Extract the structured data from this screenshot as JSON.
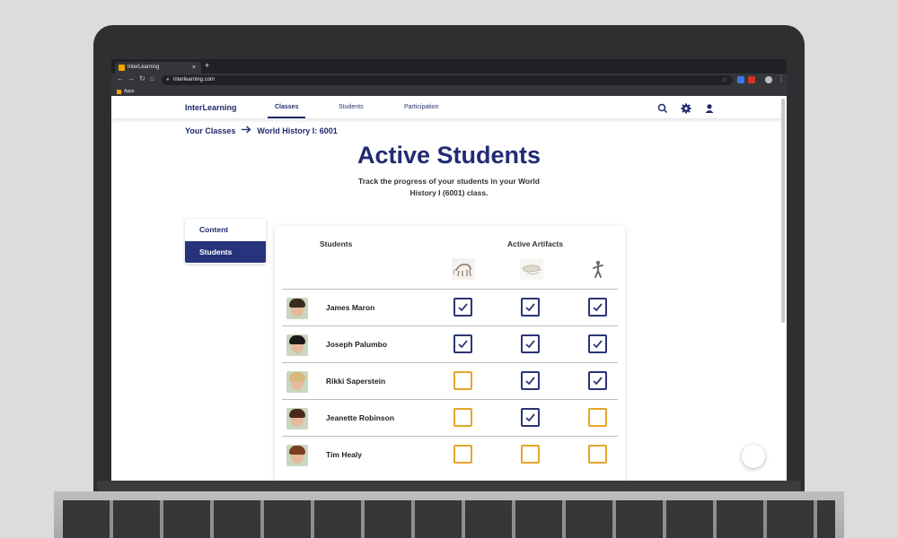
{
  "browser": {
    "tab_title": "InterLearning",
    "tab_close": "×",
    "new_tab": "+",
    "url": "interlearning.com",
    "bookmarks": [
      {
        "label": "Apps"
      }
    ]
  },
  "nav": {
    "brand": "InterLearning",
    "links": [
      "Classes",
      "Students",
      "Participation"
    ],
    "active_link": "Classes",
    "icons": [
      "search-icon",
      "gear-icon",
      "user-icon"
    ]
  },
  "breadcrumb": {
    "items": [
      "Your Classes",
      "World History I: 6001"
    ],
    "separator_icon": "arrow-right-icon"
  },
  "page": {
    "title": "Active Students",
    "subtitle_line1": "Track the progress of your students in your World",
    "subtitle_line2": "History I (6001) class."
  },
  "sidebar": {
    "items": [
      {
        "label": "Content",
        "active": false
      },
      {
        "label": "Students",
        "active": true
      }
    ]
  },
  "table": {
    "col_students": "Students",
    "col_artifacts": "Active Artifacts",
    "artifacts": [
      {
        "name": "mammoth-skeleton-icon"
      },
      {
        "name": "dinosaur-skull-icon"
      },
      {
        "name": "human-figure-statue-icon"
      }
    ],
    "rows": [
      {
        "name": "James Maron",
        "checks": [
          true,
          true,
          true
        ],
        "hair": "#3b2a1e"
      },
      {
        "name": "Joseph Palumbo",
        "checks": [
          true,
          true,
          true
        ],
        "hair": "#1e1a18"
      },
      {
        "name": "Rikki Saperstein",
        "checks": [
          false,
          true,
          true
        ],
        "hair": "#d8b878"
      },
      {
        "name": "Jeanette Robinson",
        "checks": [
          false,
          true,
          false
        ],
        "hair": "#4a2a1a"
      },
      {
        "name": "Tim Healy",
        "checks": [
          false,
          false,
          false
        ],
        "hair": "#7a3e22"
      }
    ]
  },
  "colors": {
    "brand_navy": "#222b73",
    "checked_border": "#2a3575",
    "unchecked_border": "#e3a52b"
  }
}
